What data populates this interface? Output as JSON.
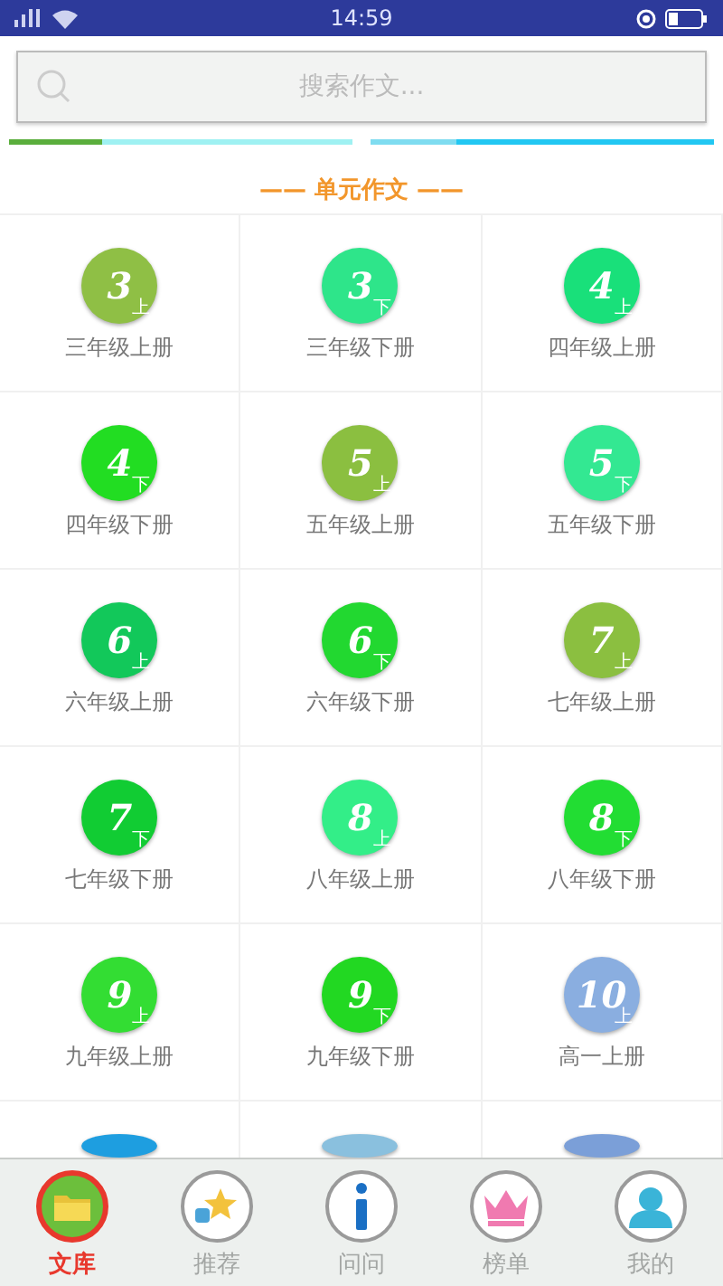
{
  "status_bar": {
    "time": "14:59"
  },
  "search": {
    "placeholder": "搜索作文..."
  },
  "section_title": "—— 单元作文 ——",
  "grid": [
    {
      "kind": "book",
      "grade": "3",
      "term": "上",
      "label": "三年级上册",
      "color": "#8fbf45"
    },
    {
      "kind": "book",
      "grade": "3",
      "term": "下",
      "label": "三年级下册",
      "color": "#2ee58a"
    },
    {
      "kind": "book",
      "grade": "4",
      "term": "上",
      "label": "四年级上册",
      "color": "#19e07a"
    },
    {
      "kind": "book",
      "grade": "4",
      "term": "下",
      "label": "四年级下册",
      "color": "#22dd22"
    },
    {
      "kind": "book",
      "grade": "5",
      "term": "上",
      "label": "五年级上册",
      "color": "#8bbf40"
    },
    {
      "kind": "book",
      "grade": "5",
      "term": "下",
      "label": "五年级下册",
      "color": "#33e892"
    },
    {
      "kind": "book",
      "grade": "6",
      "term": "上",
      "label": "六年级上册",
      "color": "#12c85a"
    },
    {
      "kind": "book",
      "grade": "6",
      "term": "下",
      "label": "六年级下册",
      "color": "#22d830"
    },
    {
      "kind": "book",
      "grade": "7",
      "term": "上",
      "label": "七年级上册",
      "color": "#8bbf40"
    },
    {
      "kind": "book",
      "grade": "7",
      "term": "下",
      "label": "七年级下册",
      "color": "#11cc33"
    },
    {
      "kind": "book",
      "grade": "8",
      "term": "上",
      "label": "八年级上册",
      "color": "#33ee88"
    },
    {
      "kind": "book",
      "grade": "8",
      "term": "下",
      "label": "八年级下册",
      "color": "#22dd33"
    },
    {
      "kind": "book",
      "grade": "9",
      "term": "上",
      "label": "九年级上册",
      "color": "#33dd33"
    },
    {
      "kind": "book",
      "grade": "9",
      "term": "下",
      "label": "九年级下册",
      "color": "#22d822"
    },
    {
      "kind": "book",
      "grade": "10",
      "term": "上",
      "label": "高一上册",
      "color": "#8aaee0"
    },
    {
      "kind": "covered",
      "color": "#1e9ee0"
    },
    {
      "kind": "covered",
      "color": "#8ac0de"
    },
    {
      "kind": "covered",
      "color": "#7b9fd8"
    }
  ],
  "tab_bar": [
    {
      "kind": "folder",
      "label": "文库",
      "selected": true
    },
    {
      "kind": "star",
      "label": "推荐",
      "selected": false
    },
    {
      "kind": "info",
      "label": "问问",
      "selected": false
    },
    {
      "kind": "crown",
      "label": "榜单",
      "selected": false
    },
    {
      "kind": "person",
      "label": "我的",
      "selected": false
    }
  ]
}
